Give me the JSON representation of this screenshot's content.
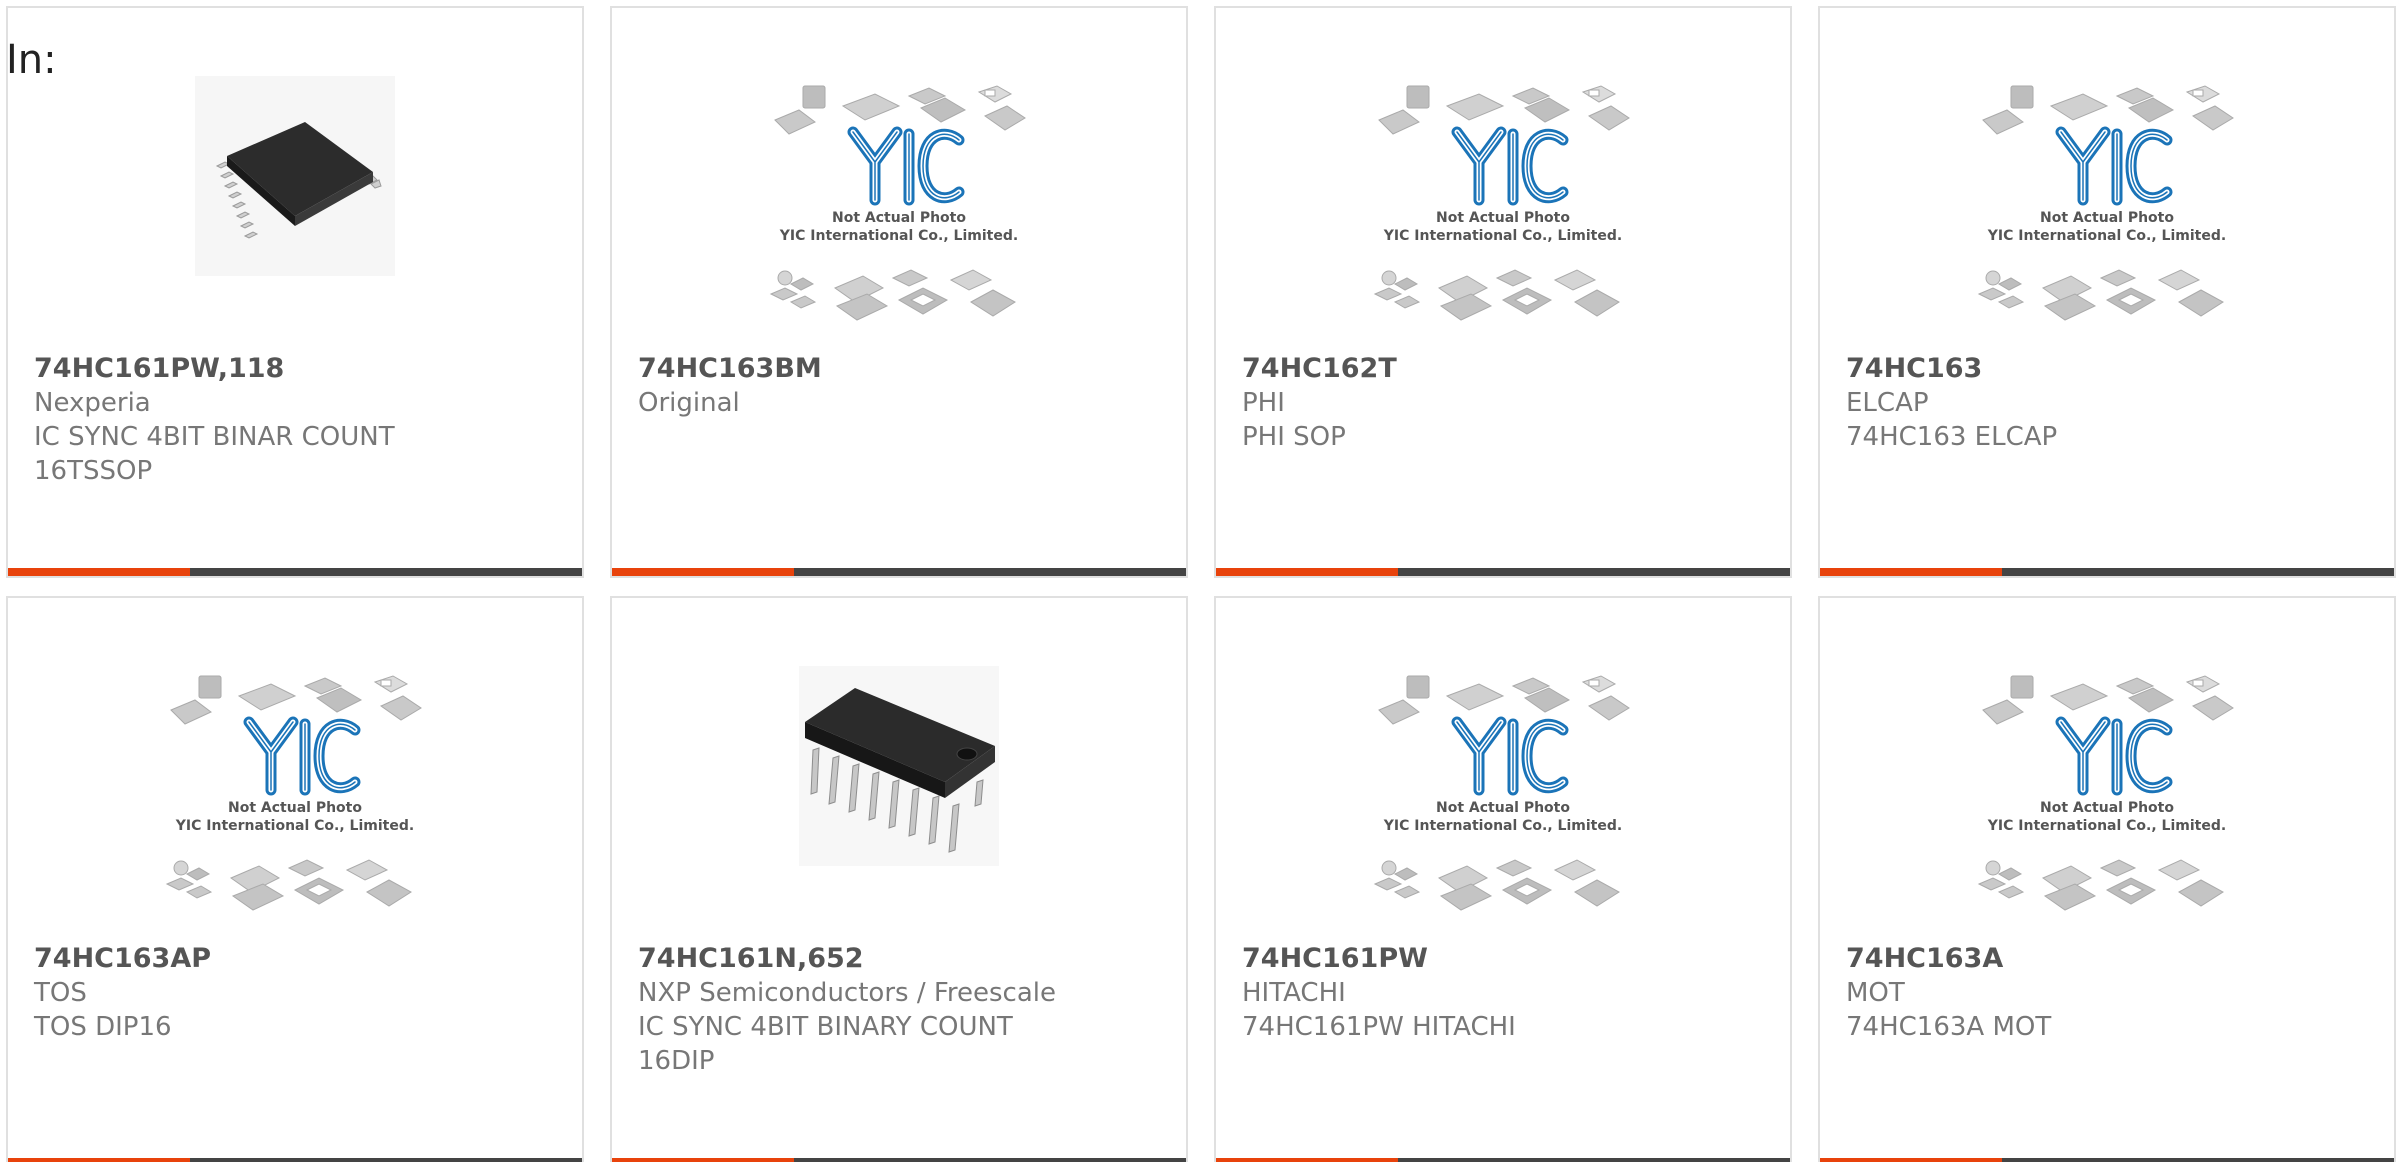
{
  "header": {
    "label": "In:"
  },
  "colors": {
    "accent": "#e8430c",
    "bar": "#444444",
    "border": "#e0e0e0",
    "logo_blue": "#1b74b8"
  },
  "placeholder": {
    "line1": "Not Actual Photo",
    "line2": "YIC International Co., Limited.",
    "logo": "YIC"
  },
  "cards": [
    {
      "part_number": "74HC161PW,118",
      "manufacturer": "Nexperia",
      "description_1": "IC SYNC 4BIT BINAR COUNT",
      "description_2": "16TSSOP",
      "image": "tssop-chip-photo"
    },
    {
      "part_number": "74HC163BM",
      "manufacturer": "Original",
      "description_1": "",
      "description_2": "",
      "image": "placeholder"
    },
    {
      "part_number": "74HC162T",
      "manufacturer": "PHI",
      "description_1": "PHI SOP",
      "description_2": "",
      "image": "placeholder"
    },
    {
      "part_number": "74HC163",
      "manufacturer": "ELCAP",
      "description_1": "74HC163 ELCAP",
      "description_2": "",
      "image": "placeholder"
    },
    {
      "part_number": "74HC163AP",
      "manufacturer": "TOS",
      "description_1": "TOS DIP16",
      "description_2": "",
      "image": "placeholder"
    },
    {
      "part_number": "74HC161N,652",
      "manufacturer": "NXP Semiconductors / Freescale",
      "description_1": "IC SYNC 4BIT BINARY COUNT",
      "description_2": "16DIP",
      "image": "dip-chip-photo"
    },
    {
      "part_number": "74HC161PW",
      "manufacturer": "HITACHI",
      "description_1": "74HC161PW HITACHI",
      "description_2": "",
      "image": "placeholder"
    },
    {
      "part_number": "74HC163A",
      "manufacturer": "MOT",
      "description_1": "74HC163A MOT",
      "description_2": "",
      "image": "placeholder"
    }
  ]
}
